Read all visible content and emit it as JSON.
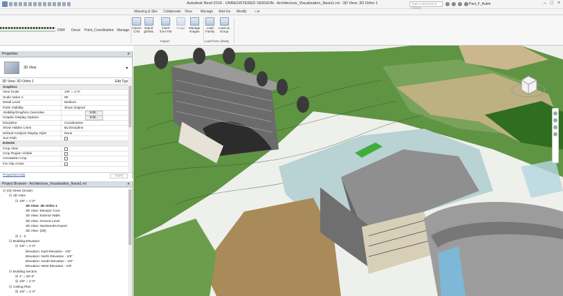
{
  "window": {
    "title": "Autodesk Revit 2016 - UNREGISTERED VERSION -   Architecture_Visualization_Navis1.rvt - 3D View: 3D Ortho 1",
    "search_placeholder": "Type a keyword or phrase",
    "user": "Paul_F_Aubin",
    "controls": [
      "–",
      "□",
      "×"
    ]
  },
  "tabs": [
    "Massing & Site",
    "Collaborate",
    "View",
    "Manage",
    "Add-Ins",
    "Modify",
    "▭▾"
  ],
  "ribbon": {
    "left_labels": [
      "DWF",
      "Decal",
      "Point_Coordination",
      "Manage"
    ],
    "buttons": [
      {
        "label": "Import\nCAD",
        "icon": "import-cad-icon"
      },
      {
        "label": "Import\ngbXML",
        "icon": "import-gbxml-icon"
      },
      {
        "label": "Insert\nfrom File",
        "icon": "insert-from-file-icon"
      },
      {
        "label": "Image",
        "icon": "image-icon"
      },
      {
        "label": "Manage\nImages",
        "icon": "manage-images-icon"
      },
      {
        "label": "Load\nFamily",
        "icon": "load-family-icon"
      },
      {
        "label": "Load as\nGroup",
        "icon": "load-as-group-icon"
      }
    ],
    "groups": [
      "Import",
      "Load from Library"
    ]
  },
  "properties": {
    "header": "Properties",
    "type_name": "3D View",
    "instance": "3D View: 3D Ortho 1",
    "edit_type": "Edit Type",
    "rows": [
      {
        "k": "Graphics",
        "v": "",
        "group": true
      },
      {
        "k": "View Scale",
        "v": "1/8\" = 1'-0\""
      },
      {
        "k": "Scale Value    1:",
        "v": "96"
      },
      {
        "k": "Detail Level",
        "v": "Medium"
      },
      {
        "k": "Parts Visibility",
        "v": "Show Original"
      },
      {
        "k": "Visibility/Graphics Overrides",
        "v": "Edit...",
        "button": true
      },
      {
        "k": "Graphic Display Options",
        "v": "Edit...",
        "button": true
      },
      {
        "k": "Discipline",
        "v": "Coordination"
      },
      {
        "k": "Show Hidden Lines",
        "v": "By Discipline"
      },
      {
        "k": "Default Analysis Display Style",
        "v": "None"
      },
      {
        "k": "Sun Path",
        "v": "",
        "check": true
      },
      {
        "k": "Extents",
        "v": "",
        "group": true
      },
      {
        "k": "Crop View",
        "v": "",
        "check": true
      },
      {
        "k": "Crop Region Visible",
        "v": "",
        "check": true
      },
      {
        "k": "Annotation Crop",
        "v": "",
        "check": true
      },
      {
        "k": "Far Clip Active",
        "v": "",
        "check": true
      }
    ],
    "help": "Properties help",
    "apply": "Apply"
  },
  "browser": {
    "header": "Project Browser - Architecture_Visualization_Navis1.rvt",
    "items": [
      {
        "text": "[O] Views (Scale)",
        "depth": 0,
        "toggle": "⊟"
      },
      {
        "text": "3D View",
        "depth": 1,
        "toggle": "⊟"
      },
      {
        "text": "1/8\" = 1'-0\"",
        "depth": 2,
        "toggle": "⊟"
      },
      {
        "text": "3D View: 3D Ortho 1",
        "depth": 3,
        "toggle": "",
        "bold": true
      },
      {
        "text": "3D View: Elevator Core",
        "depth": 3,
        "toggle": ""
      },
      {
        "text": "3D View: Exterior Walls",
        "depth": 3,
        "toggle": ""
      },
      {
        "text": "3D View: Ground Level",
        "depth": 3,
        "toggle": ""
      },
      {
        "text": "3D View: Navisworks Export",
        "depth": 3,
        "toggle": ""
      },
      {
        "text": "3D View: {3D}",
        "depth": 3,
        "toggle": ""
      },
      {
        "text": "1 : 0",
        "depth": 2,
        "toggle": "⊞"
      },
      {
        "text": "Building Elevation",
        "depth": 1,
        "toggle": "⊟"
      },
      {
        "text": "1/8\" = 1'-0\"",
        "depth": 2,
        "toggle": "⊟"
      },
      {
        "text": "Elevation: East Elevation - 1/8\"",
        "depth": 3,
        "toggle": ""
      },
      {
        "text": "Elevation: North Elevation - 1/8\"",
        "depth": 3,
        "toggle": ""
      },
      {
        "text": "Elevation: South Elevation - 1/8\"",
        "depth": 3,
        "toggle": ""
      },
      {
        "text": "Elevation: West Elevation - 1/8\"",
        "depth": 3,
        "toggle": ""
      },
      {
        "text": "Building Section",
        "depth": 1,
        "toggle": "⊟"
      },
      {
        "text": "1\" = 20'-0\"",
        "depth": 2,
        "toggle": "⊞"
      },
      {
        "text": "1/8\" = 1'-0\"",
        "depth": 2,
        "toggle": "⊞"
      },
      {
        "text": "Ceiling Plan",
        "depth": 1,
        "toggle": "⊟"
      },
      {
        "text": "1/8\" = 1'-0\"",
        "depth": 2,
        "toggle": "⊞"
      }
    ]
  },
  "colors": {
    "panel_header": "#d8dde4",
    "grass": "#5a8e3e",
    "grass_light": "#8ab36a",
    "sand": "#c9b488",
    "roof": "#8f8f8f",
    "accent_green": "#3fae3a"
  }
}
